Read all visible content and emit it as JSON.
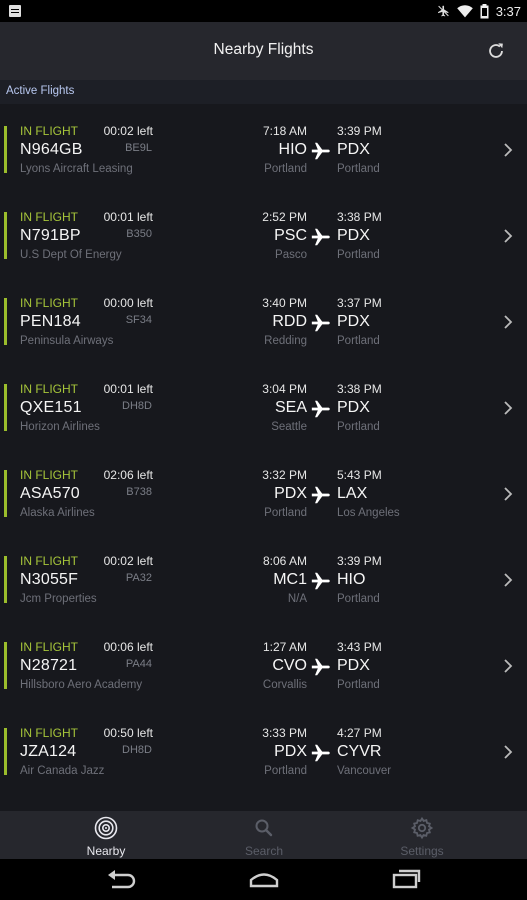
{
  "status_bar": {
    "time": "3:37"
  },
  "app_bar": {
    "title": "Nearby Flights",
    "refresh_icon": "refresh-icon"
  },
  "section": {
    "title": "Active Flights"
  },
  "flights": [
    {
      "status": "IN FLIGHT",
      "time_left": "00:02 left",
      "callsign": "N964GB",
      "aircraft": "BE9L",
      "operator": "Lyons Aircraft Leasing",
      "dep_time": "7:18 AM",
      "dep_code": "HIO",
      "dep_city": "Portland",
      "arr_time": "3:39 PM",
      "arr_code": "PDX",
      "arr_city": "Portland"
    },
    {
      "status": "IN FLIGHT",
      "time_left": "00:01 left",
      "callsign": "N791BP",
      "aircraft": "B350",
      "operator": "U.S Dept Of Energy",
      "dep_time": "2:52 PM",
      "dep_code": "PSC",
      "dep_city": "Pasco",
      "arr_time": "3:38 PM",
      "arr_code": "PDX",
      "arr_city": "Portland"
    },
    {
      "status": "IN FLIGHT",
      "time_left": "00:00 left",
      "callsign": "PEN184",
      "aircraft": "SF34",
      "operator": "Peninsula Airways",
      "dep_time": "3:40 PM",
      "dep_code": "RDD",
      "dep_city": "Redding",
      "arr_time": "3:37 PM",
      "arr_code": "PDX",
      "arr_city": "Portland"
    },
    {
      "status": "IN FLIGHT",
      "time_left": "00:01 left",
      "callsign": "QXE151",
      "aircraft": "DH8D",
      "operator": "Horizon Airlines",
      "dep_time": "3:04 PM",
      "dep_code": "SEA",
      "dep_city": "Seattle",
      "arr_time": "3:38 PM",
      "arr_code": "PDX",
      "arr_city": "Portland"
    },
    {
      "status": "IN FLIGHT",
      "time_left": "02:06 left",
      "callsign": "ASA570",
      "aircraft": "B738",
      "operator": "Alaska Airlines",
      "dep_time": "3:32 PM",
      "dep_code": "PDX",
      "dep_city": "Portland",
      "arr_time": "5:43 PM",
      "arr_code": "LAX",
      "arr_city": "Los Angeles"
    },
    {
      "status": "IN FLIGHT",
      "time_left": "00:02 left",
      "callsign": "N3055F",
      "aircraft": "PA32",
      "operator": "Jcm Properties",
      "dep_time": "8:06 AM",
      "dep_code": "MC1",
      "dep_city": "N/A",
      "arr_time": "3:39 PM",
      "arr_code": "HIO",
      "arr_city": "Portland"
    },
    {
      "status": "IN FLIGHT",
      "time_left": "00:06 left",
      "callsign": "N28721",
      "aircraft": "PA44",
      "operator": "Hillsboro Aero Academy",
      "dep_time": "1:27 AM",
      "dep_code": "CVO",
      "dep_city": "Corvallis",
      "arr_time": "3:43 PM",
      "arr_code": "PDX",
      "arr_city": "Portland"
    },
    {
      "status": "IN FLIGHT",
      "time_left": "00:50 left",
      "callsign": "JZA124",
      "aircraft": "DH8D",
      "operator": "Air Canada Jazz",
      "dep_time": "3:33 PM",
      "dep_code": "PDX",
      "dep_city": "Portland",
      "arr_time": "4:27 PM",
      "arr_code": "CYVR",
      "arr_city": "Vancouver"
    }
  ],
  "bottom_nav": {
    "items": [
      {
        "label": "Nearby",
        "icon": "radar-icon",
        "active": true
      },
      {
        "label": "Search",
        "icon": "search-icon",
        "active": false
      },
      {
        "label": "Settings",
        "icon": "gear-icon",
        "active": false
      }
    ]
  },
  "colors": {
    "accent": "#9bbd2c",
    "background": "#17181d",
    "app_bar": "#26272d",
    "section_header": "#1d1f26"
  }
}
